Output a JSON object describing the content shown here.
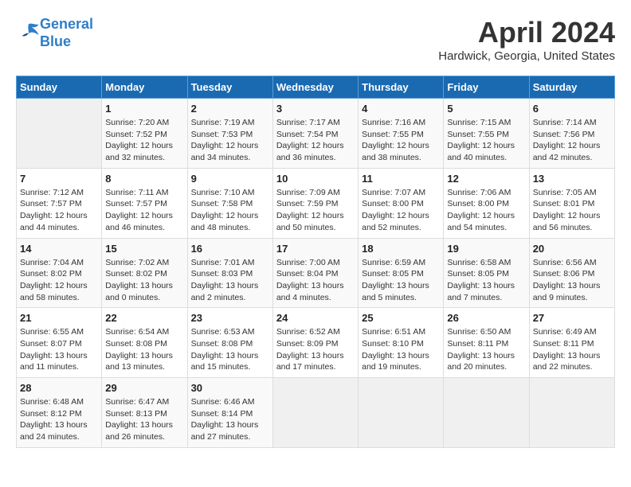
{
  "header": {
    "logo_line1": "General",
    "logo_line2": "Blue",
    "title": "April 2024",
    "subtitle": "Hardwick, Georgia, United States"
  },
  "days_of_week": [
    "Sunday",
    "Monday",
    "Tuesday",
    "Wednesday",
    "Thursday",
    "Friday",
    "Saturday"
  ],
  "weeks": [
    [
      {
        "day": "",
        "info": ""
      },
      {
        "day": "1",
        "info": "Sunrise: 7:20 AM\nSunset: 7:52 PM\nDaylight: 12 hours\nand 32 minutes."
      },
      {
        "day": "2",
        "info": "Sunrise: 7:19 AM\nSunset: 7:53 PM\nDaylight: 12 hours\nand 34 minutes."
      },
      {
        "day": "3",
        "info": "Sunrise: 7:17 AM\nSunset: 7:54 PM\nDaylight: 12 hours\nand 36 minutes."
      },
      {
        "day": "4",
        "info": "Sunrise: 7:16 AM\nSunset: 7:55 PM\nDaylight: 12 hours\nand 38 minutes."
      },
      {
        "day": "5",
        "info": "Sunrise: 7:15 AM\nSunset: 7:55 PM\nDaylight: 12 hours\nand 40 minutes."
      },
      {
        "day": "6",
        "info": "Sunrise: 7:14 AM\nSunset: 7:56 PM\nDaylight: 12 hours\nand 42 minutes."
      }
    ],
    [
      {
        "day": "7",
        "info": "Sunrise: 7:12 AM\nSunset: 7:57 PM\nDaylight: 12 hours\nand 44 minutes."
      },
      {
        "day": "8",
        "info": "Sunrise: 7:11 AM\nSunset: 7:57 PM\nDaylight: 12 hours\nand 46 minutes."
      },
      {
        "day": "9",
        "info": "Sunrise: 7:10 AM\nSunset: 7:58 PM\nDaylight: 12 hours\nand 48 minutes."
      },
      {
        "day": "10",
        "info": "Sunrise: 7:09 AM\nSunset: 7:59 PM\nDaylight: 12 hours\nand 50 minutes."
      },
      {
        "day": "11",
        "info": "Sunrise: 7:07 AM\nSunset: 8:00 PM\nDaylight: 12 hours\nand 52 minutes."
      },
      {
        "day": "12",
        "info": "Sunrise: 7:06 AM\nSunset: 8:00 PM\nDaylight: 12 hours\nand 54 minutes."
      },
      {
        "day": "13",
        "info": "Sunrise: 7:05 AM\nSunset: 8:01 PM\nDaylight: 12 hours\nand 56 minutes."
      }
    ],
    [
      {
        "day": "14",
        "info": "Sunrise: 7:04 AM\nSunset: 8:02 PM\nDaylight: 12 hours\nand 58 minutes."
      },
      {
        "day": "15",
        "info": "Sunrise: 7:02 AM\nSunset: 8:02 PM\nDaylight: 13 hours\nand 0 minutes."
      },
      {
        "day": "16",
        "info": "Sunrise: 7:01 AM\nSunset: 8:03 PM\nDaylight: 13 hours\nand 2 minutes."
      },
      {
        "day": "17",
        "info": "Sunrise: 7:00 AM\nSunset: 8:04 PM\nDaylight: 13 hours\nand 4 minutes."
      },
      {
        "day": "18",
        "info": "Sunrise: 6:59 AM\nSunset: 8:05 PM\nDaylight: 13 hours\nand 5 minutes."
      },
      {
        "day": "19",
        "info": "Sunrise: 6:58 AM\nSunset: 8:05 PM\nDaylight: 13 hours\nand 7 minutes."
      },
      {
        "day": "20",
        "info": "Sunrise: 6:56 AM\nSunset: 8:06 PM\nDaylight: 13 hours\nand 9 minutes."
      }
    ],
    [
      {
        "day": "21",
        "info": "Sunrise: 6:55 AM\nSunset: 8:07 PM\nDaylight: 13 hours\nand 11 minutes."
      },
      {
        "day": "22",
        "info": "Sunrise: 6:54 AM\nSunset: 8:08 PM\nDaylight: 13 hours\nand 13 minutes."
      },
      {
        "day": "23",
        "info": "Sunrise: 6:53 AM\nSunset: 8:08 PM\nDaylight: 13 hours\nand 15 minutes."
      },
      {
        "day": "24",
        "info": "Sunrise: 6:52 AM\nSunset: 8:09 PM\nDaylight: 13 hours\nand 17 minutes."
      },
      {
        "day": "25",
        "info": "Sunrise: 6:51 AM\nSunset: 8:10 PM\nDaylight: 13 hours\nand 19 minutes."
      },
      {
        "day": "26",
        "info": "Sunrise: 6:50 AM\nSunset: 8:11 PM\nDaylight: 13 hours\nand 20 minutes."
      },
      {
        "day": "27",
        "info": "Sunrise: 6:49 AM\nSunset: 8:11 PM\nDaylight: 13 hours\nand 22 minutes."
      }
    ],
    [
      {
        "day": "28",
        "info": "Sunrise: 6:48 AM\nSunset: 8:12 PM\nDaylight: 13 hours\nand 24 minutes."
      },
      {
        "day": "29",
        "info": "Sunrise: 6:47 AM\nSunset: 8:13 PM\nDaylight: 13 hours\nand 26 minutes."
      },
      {
        "day": "30",
        "info": "Sunrise: 6:46 AM\nSunset: 8:14 PM\nDaylight: 13 hours\nand 27 minutes."
      },
      {
        "day": "",
        "info": ""
      },
      {
        "day": "",
        "info": ""
      },
      {
        "day": "",
        "info": ""
      },
      {
        "day": "",
        "info": ""
      }
    ]
  ]
}
